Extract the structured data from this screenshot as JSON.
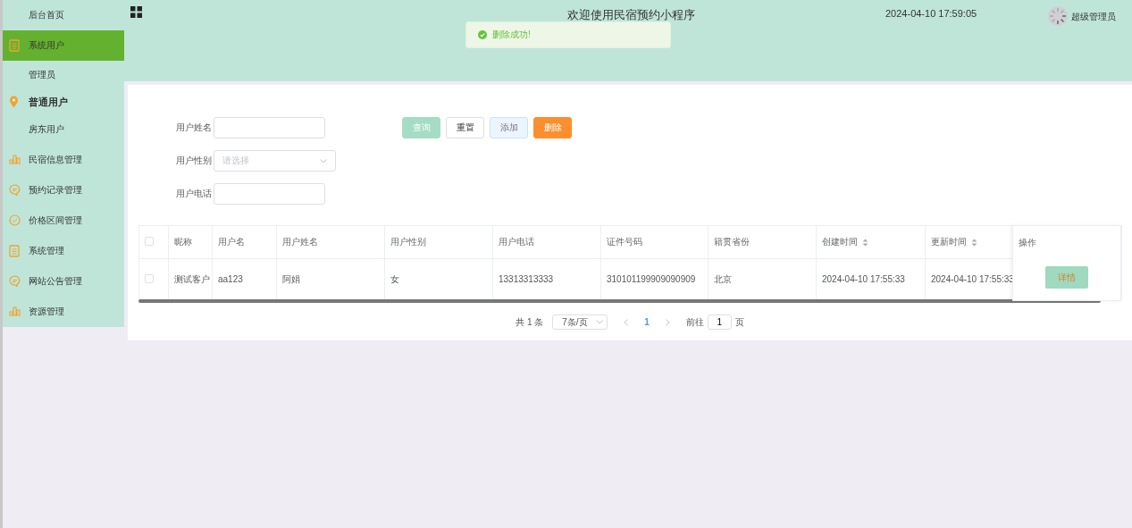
{
  "sidebar": {
    "items": [
      {
        "label": "后台首页",
        "kind": "plain",
        "selected": false
      },
      {
        "label": "系统用户",
        "kind": "doc",
        "selected": true,
        "children": [
          {
            "label": "管理员",
            "selected": false
          }
        ]
      },
      {
        "label": "普通用户",
        "kind": "pin",
        "selected": false,
        "expanded": true,
        "children": [
          {
            "label": "房东用户",
            "selected": false
          }
        ]
      },
      {
        "label": "民宿信息管理",
        "kind": "bars",
        "selected": false
      },
      {
        "label": "预约记录管理",
        "kind": "chat",
        "selected": false
      },
      {
        "label": "价格区间管理",
        "kind": "check",
        "selected": false
      },
      {
        "label": "系统管理",
        "kind": "doc",
        "selected": false
      },
      {
        "label": "网站公告管理",
        "kind": "chat",
        "selected": false
      },
      {
        "label": "资源管理",
        "kind": "bars",
        "selected": false
      }
    ]
  },
  "header": {
    "title": "欢迎使用民宿预约小程序",
    "datetime": "2024-04-10 17:59:05",
    "user": "超级管理员"
  },
  "toast": {
    "message": "删除成功!"
  },
  "search": {
    "fields": [
      {
        "label": "用户姓名",
        "kind": "text"
      },
      {
        "label": "用户性别",
        "kind": "select",
        "placeholder": "请选择"
      },
      {
        "label": "用户电话",
        "kind": "text"
      }
    ],
    "buttons": [
      {
        "label": "查询",
        "kind": "primary"
      },
      {
        "label": "重置",
        "kind": "plain"
      },
      {
        "label": "添加",
        "kind": "hover"
      },
      {
        "label": "删除",
        "kind": "danger"
      }
    ]
  },
  "table": {
    "columns": [
      {
        "label": "昵称",
        "sortable": false
      },
      {
        "label": "用户名",
        "sortable": false
      },
      {
        "label": "用户姓名",
        "sortable": false
      },
      {
        "label": "用户性别",
        "sortable": false
      },
      {
        "label": "用户电话",
        "sortable": false
      },
      {
        "label": "证件号码",
        "sortable": false
      },
      {
        "label": "籍贯省份",
        "sortable": false
      },
      {
        "label": "创建时间",
        "sortable": true
      },
      {
        "label": "更新时间",
        "sortable": true
      }
    ],
    "action_column": "操作",
    "all_checked": false,
    "rows": [
      {
        "checked": false,
        "cells": [
          "测试客户",
          "aa123",
          "阿娟",
          "女",
          "13313313333",
          "310101199909090909",
          "北京",
          "2024-04-10 17:55:33",
          "2024-04-10 17:55:33"
        ],
        "action": "详情"
      }
    ]
  },
  "pagination": {
    "total": "共 1 条",
    "page_size": "7条/页",
    "pages": [
      {
        "label": "1",
        "selected": true
      }
    ],
    "goto_label": "前往",
    "goto_value": "1",
    "page_unit": "页"
  }
}
